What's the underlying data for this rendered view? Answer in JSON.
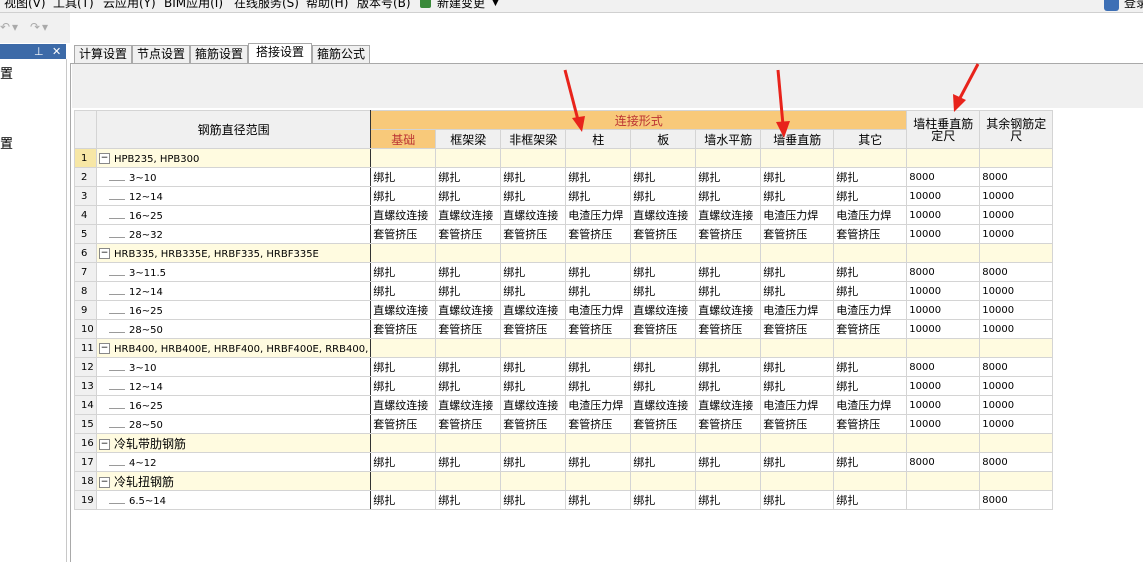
{
  "menubar": {
    "items": [
      "视图(V)",
      "工具(T)",
      "云应用(Y)",
      "BIM应用(I)",
      "在线服务(S)",
      "帮助(H)",
      "版本号(B)",
      "新建变更"
    ],
    "login": "登录"
  },
  "left_panel": {
    "items": [
      "置",
      "置"
    ]
  },
  "tabs": [
    "计算设置",
    "节点设置",
    "箍筋设置",
    "搭接设置",
    "箍筋公式"
  ],
  "active_tab": "搭接设置",
  "grid": {
    "header": {
      "range": "钢筋直径范围",
      "connection": "连接形式",
      "columns": [
        "基础",
        "框架梁",
        "非框架梁",
        "柱",
        "板",
        "墙水平筋",
        "墙垂直筋",
        "其它"
      ],
      "wall_col": "墙柱垂直筋定尺",
      "other_col": "其余钢筋定尺"
    },
    "rows": [
      {
        "n": "1",
        "type": "group",
        "label": "HPB235, HPB300"
      },
      {
        "n": "2",
        "type": "item",
        "label": "3~10",
        "c": [
          "绑扎",
          "绑扎",
          "绑扎",
          "绑扎",
          "绑扎",
          "绑扎",
          "绑扎",
          "绑扎"
        ],
        "w": "8000",
        "o": "8000"
      },
      {
        "n": "3",
        "type": "item",
        "label": "12~14",
        "c": [
          "绑扎",
          "绑扎",
          "绑扎",
          "绑扎",
          "绑扎",
          "绑扎",
          "绑扎",
          "绑扎"
        ],
        "w": "10000",
        "o": "10000"
      },
      {
        "n": "4",
        "type": "item",
        "label": "16~25",
        "c": [
          "直螺纹连接",
          "直螺纹连接",
          "直螺纹连接",
          "电渣压力焊",
          "直螺纹连接",
          "直螺纹连接",
          "电渣压力焊",
          "电渣压力焊"
        ],
        "w": "10000",
        "o": "10000"
      },
      {
        "n": "5",
        "type": "item",
        "label": "28~32",
        "c": [
          "套管挤压",
          "套管挤压",
          "套管挤压",
          "套管挤压",
          "套管挤压",
          "套管挤压",
          "套管挤压",
          "套管挤压"
        ],
        "w": "10000",
        "o": "10000"
      },
      {
        "n": "6",
        "type": "group",
        "label": "HRB335, HRB335E, HRBF335, HRBF335E"
      },
      {
        "n": "7",
        "type": "item",
        "label": "3~11.5",
        "c": [
          "绑扎",
          "绑扎",
          "绑扎",
          "绑扎",
          "绑扎",
          "绑扎",
          "绑扎",
          "绑扎"
        ],
        "w": "8000",
        "o": "8000"
      },
      {
        "n": "8",
        "type": "item",
        "label": "12~14",
        "c": [
          "绑扎",
          "绑扎",
          "绑扎",
          "绑扎",
          "绑扎",
          "绑扎",
          "绑扎",
          "绑扎"
        ],
        "w": "10000",
        "o": "10000"
      },
      {
        "n": "9",
        "type": "item",
        "label": "16~25",
        "c": [
          "直螺纹连接",
          "直螺纹连接",
          "直螺纹连接",
          "电渣压力焊",
          "直螺纹连接",
          "直螺纹连接",
          "电渣压力焊",
          "电渣压力焊"
        ],
        "w": "10000",
        "o": "10000"
      },
      {
        "n": "10",
        "type": "item",
        "label": "28~50",
        "c": [
          "套管挤压",
          "套管挤压",
          "套管挤压",
          "套管挤压",
          "套管挤压",
          "套管挤压",
          "套管挤压",
          "套管挤压"
        ],
        "w": "10000",
        "o": "10000"
      },
      {
        "n": "11",
        "type": "group",
        "label": "HRB400, HRB400E, HRBF400, HRBF400E, RRB400,"
      },
      {
        "n": "12",
        "type": "item",
        "label": "3~10",
        "c": [
          "绑扎",
          "绑扎",
          "绑扎",
          "绑扎",
          "绑扎",
          "绑扎",
          "绑扎",
          "绑扎"
        ],
        "w": "8000",
        "o": "8000"
      },
      {
        "n": "13",
        "type": "item",
        "label": "12~14",
        "c": [
          "绑扎",
          "绑扎",
          "绑扎",
          "绑扎",
          "绑扎",
          "绑扎",
          "绑扎",
          "绑扎"
        ],
        "w": "10000",
        "o": "10000"
      },
      {
        "n": "14",
        "type": "item",
        "label": "16~25",
        "c": [
          "直螺纹连接",
          "直螺纹连接",
          "直螺纹连接",
          "电渣压力焊",
          "直螺纹连接",
          "直螺纹连接",
          "电渣压力焊",
          "电渣压力焊"
        ],
        "w": "10000",
        "o": "10000"
      },
      {
        "n": "15",
        "type": "item",
        "label": "28~50",
        "c": [
          "套管挤压",
          "套管挤压",
          "套管挤压",
          "套管挤压",
          "套管挤压",
          "套管挤压",
          "套管挤压",
          "套管挤压"
        ],
        "w": "10000",
        "o": "10000"
      },
      {
        "n": "16",
        "type": "group",
        "label": "冷轧带肋钢筋"
      },
      {
        "n": "17",
        "type": "item",
        "label": "4~12",
        "c": [
          "绑扎",
          "绑扎",
          "绑扎",
          "绑扎",
          "绑扎",
          "绑扎",
          "绑扎",
          "绑扎"
        ],
        "w": "8000",
        "o": "8000"
      },
      {
        "n": "18",
        "type": "group",
        "label": "冷轧扭钢筋"
      },
      {
        "n": "19",
        "type": "item",
        "label": "6.5~14",
        "c": [
          "绑扎",
          "绑扎",
          "绑扎",
          "绑扎",
          "绑扎",
          "绑扎",
          "绑扎",
          "绑扎"
        ],
        "w": "",
        "o": "8000"
      }
    ]
  },
  "colors": {
    "header_orange": "#f8c97a",
    "group_row": "#fffbe0",
    "arrow": "#e8231b",
    "panel_blue": "#3c6aa8"
  }
}
